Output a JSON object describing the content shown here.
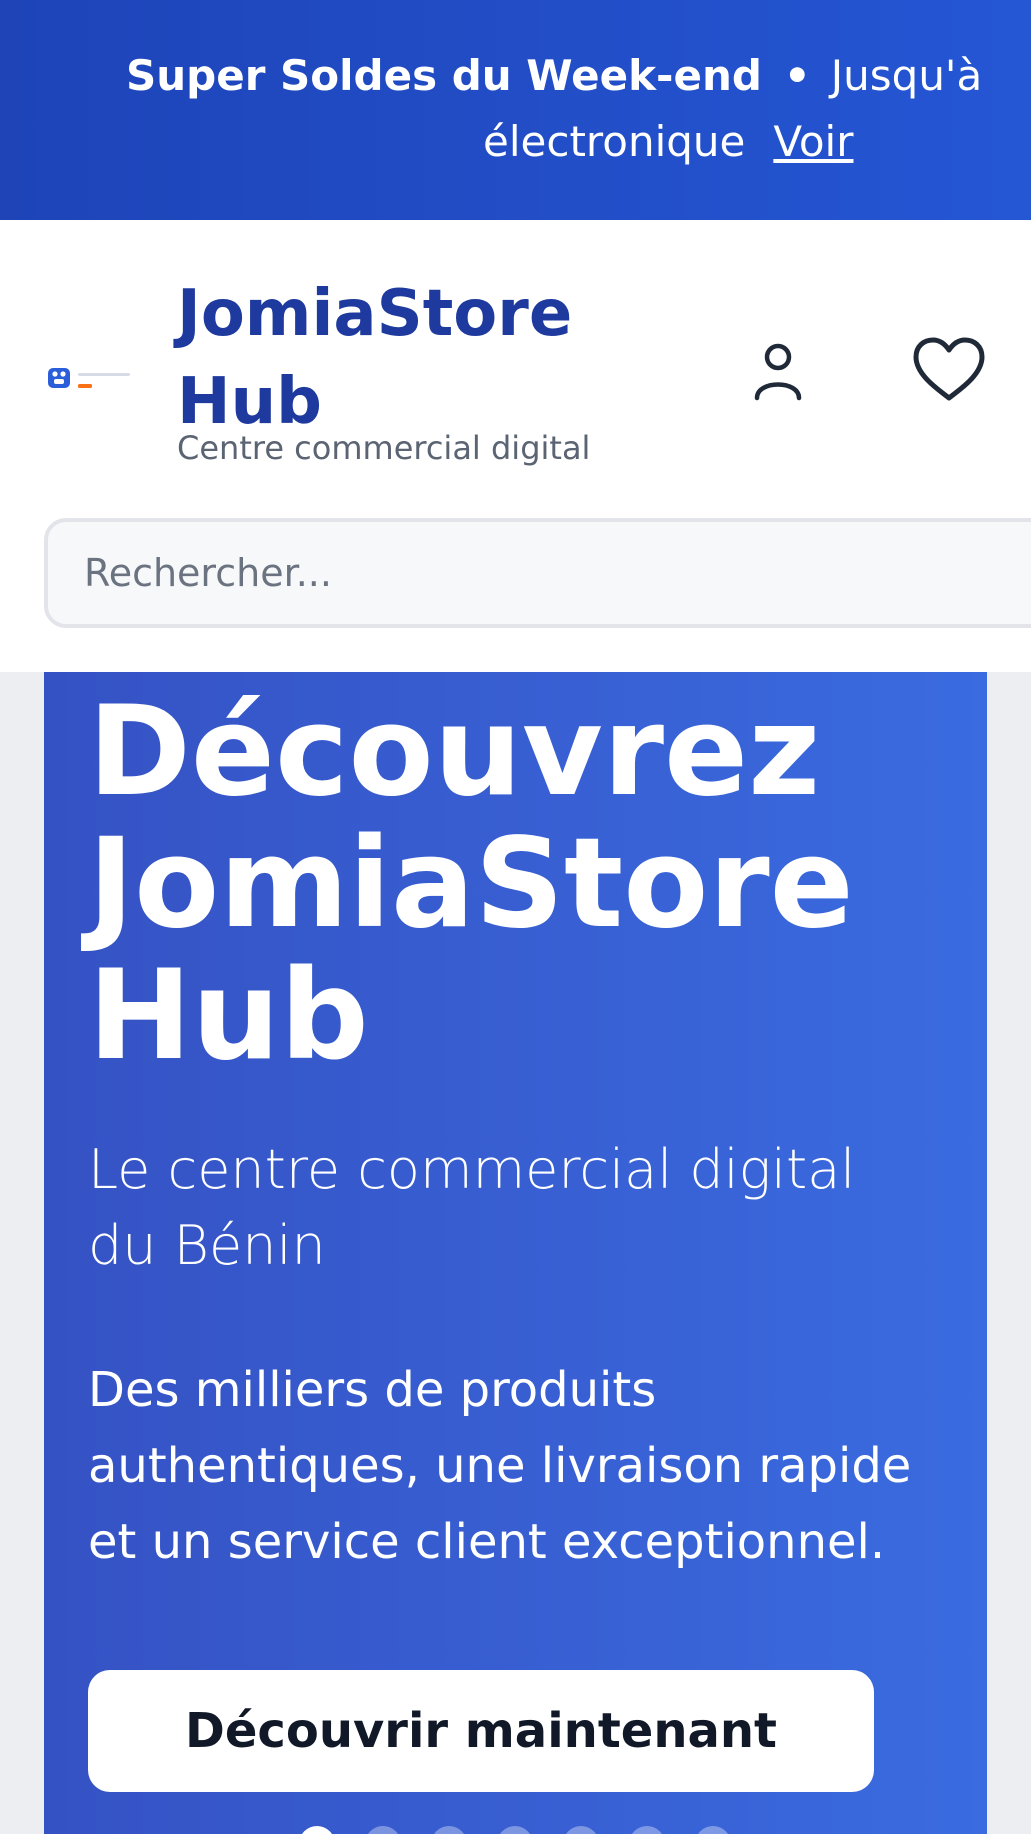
{
  "promo_banner": {
    "title": "Super Soldes du Week-end",
    "separator": "•",
    "text_line1": "Jusqu'à",
    "text_line2": "électronique",
    "link_label": "Voir"
  },
  "header": {
    "logo_text": "JomiaStore HUB",
    "brand_name": "JomiaStore Hub",
    "tagline": "Centre commercial digital",
    "account_icon": "user-icon",
    "wishlist_icon": "heart-icon"
  },
  "search": {
    "placeholder": "Rechercher...",
    "value": ""
  },
  "hero": {
    "title": "Découvrez JomiaStore Hub",
    "subtitle": "Le centre commercial digital du Bénin",
    "description": "Des milliers de produits authentiques, une livraison rapide et un service client exceptionnel.",
    "cta_label": "Découvrir maintenant",
    "carousel": {
      "slide_count": 7,
      "active_index": 0
    }
  },
  "colors": {
    "promo_bg": "#2556d4",
    "brand": "#1e3a9e",
    "hero_bg_start": "#3552c4",
    "hero_bg_end": "#3a6be0",
    "logo_orange": "#f97316"
  }
}
